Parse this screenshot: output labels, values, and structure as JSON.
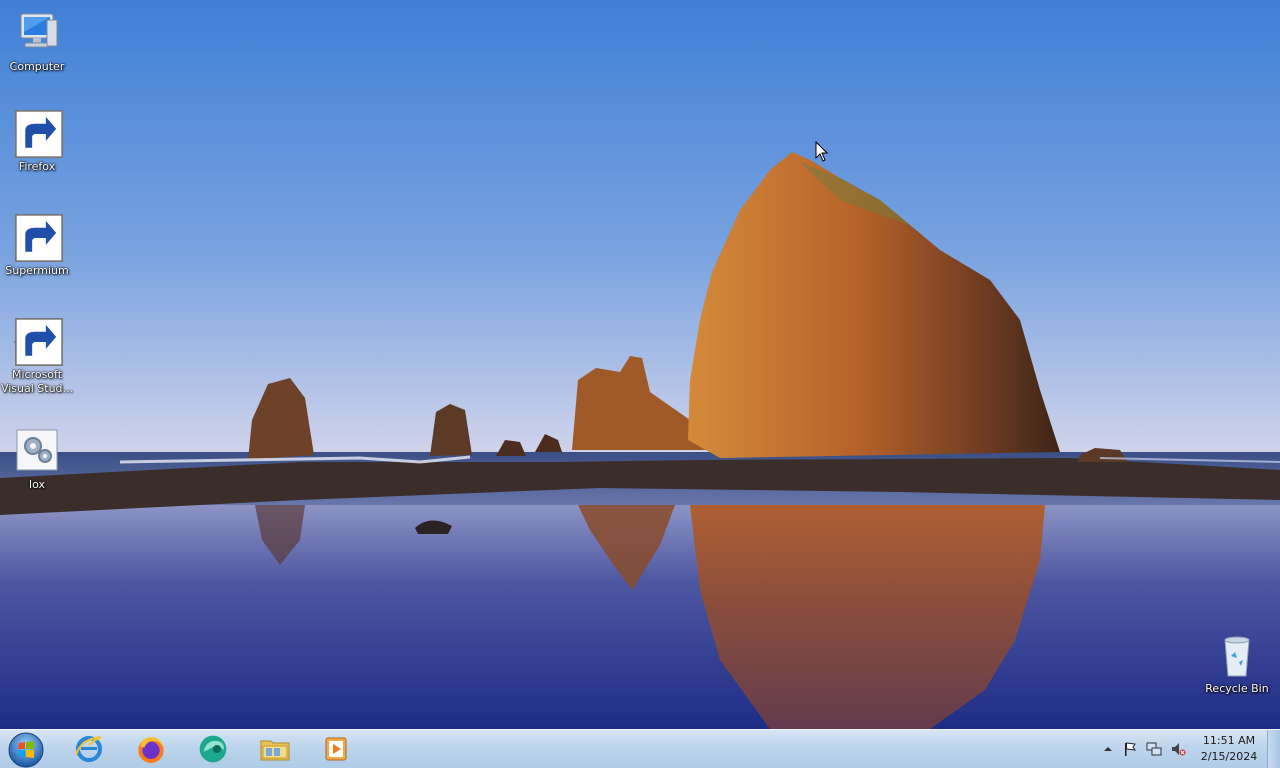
{
  "desktop": {
    "icons": [
      {
        "label": "Computer",
        "icon": "computer-icon"
      },
      {
        "label": "Firefox",
        "icon": "firefox-icon"
      },
      {
        "label": "Supermium",
        "icon": "supermium-icon"
      },
      {
        "label": "Microsoft Visual Stud...",
        "icon": "visual-studio-icon"
      },
      {
        "label": "lox",
        "icon": "lox-icon"
      },
      {
        "label": "Recycle Bin",
        "icon": "recycle-bin-icon"
      }
    ]
  },
  "taskbar": {
    "pinned": [
      {
        "name": "Internet Explorer",
        "icon": "internet-explorer-icon"
      },
      {
        "name": "Firefox",
        "icon": "firefox-icon"
      },
      {
        "name": "Supermium",
        "icon": "supermium-icon"
      },
      {
        "name": "Windows Explorer",
        "icon": "folder-icon"
      },
      {
        "name": "Windows Media Player",
        "icon": "media-player-icon"
      }
    ],
    "clock": {
      "time": "11:51 AM",
      "date": "2/15/2024"
    }
  },
  "colors": {
    "sky_top": "#3f7fd6",
    "sky_bottom": "#f2d9cd",
    "rock": "#c0712a",
    "taskbar": "#bdd4ec"
  }
}
